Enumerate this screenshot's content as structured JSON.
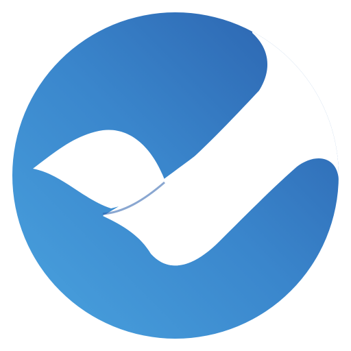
{
  "logo": {
    "icon": "checkmark-circle-logo-icon",
    "colors": {
      "background": "#ffffff",
      "gradient_light": "#4aa3df",
      "gradient_mid": "#3a86cc",
      "gradient_dark": "#2a5fab",
      "mark": "#ffffff"
    }
  }
}
